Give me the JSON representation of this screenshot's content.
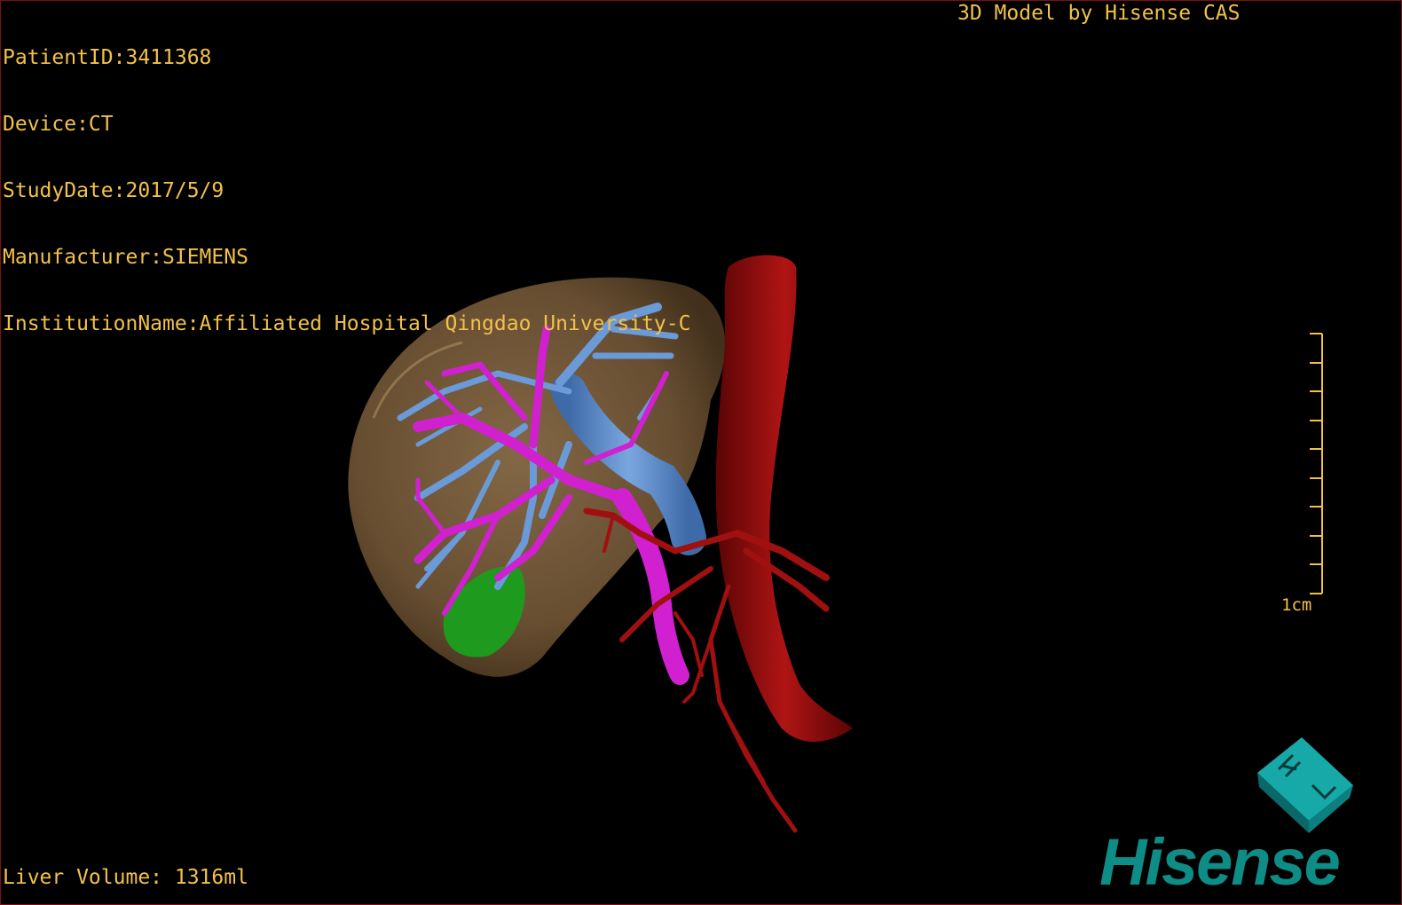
{
  "header": {
    "patient_id": "PatientID:3411368",
    "device": "Device:CT",
    "study_date": "StudyDate:2017/5/9",
    "manufacturer": "Manufacturer:SIEMENS",
    "institution": "InstitutionName:Affiliated Hospital Qingdao University-C"
  },
  "credit": "3D Model by Hisense CAS",
  "liver_volume": "Liver Volume: 1316ml",
  "scale_bar": {
    "label": "1cm"
  },
  "brand": "Hisense",
  "orientation_cube": {
    "face_letters": "H L"
  },
  "colors": {
    "text": "#f2c14a",
    "liver": "#8a6a45",
    "portal_vein": "#d020d0",
    "hepatic_vein": "#5a8ed0",
    "artery": "#a01010",
    "gallbladder": "#1e9a1e",
    "brand": "#0e8c86"
  },
  "icons": [
    "orientation-cube-icon",
    "hisense-logo"
  ]
}
